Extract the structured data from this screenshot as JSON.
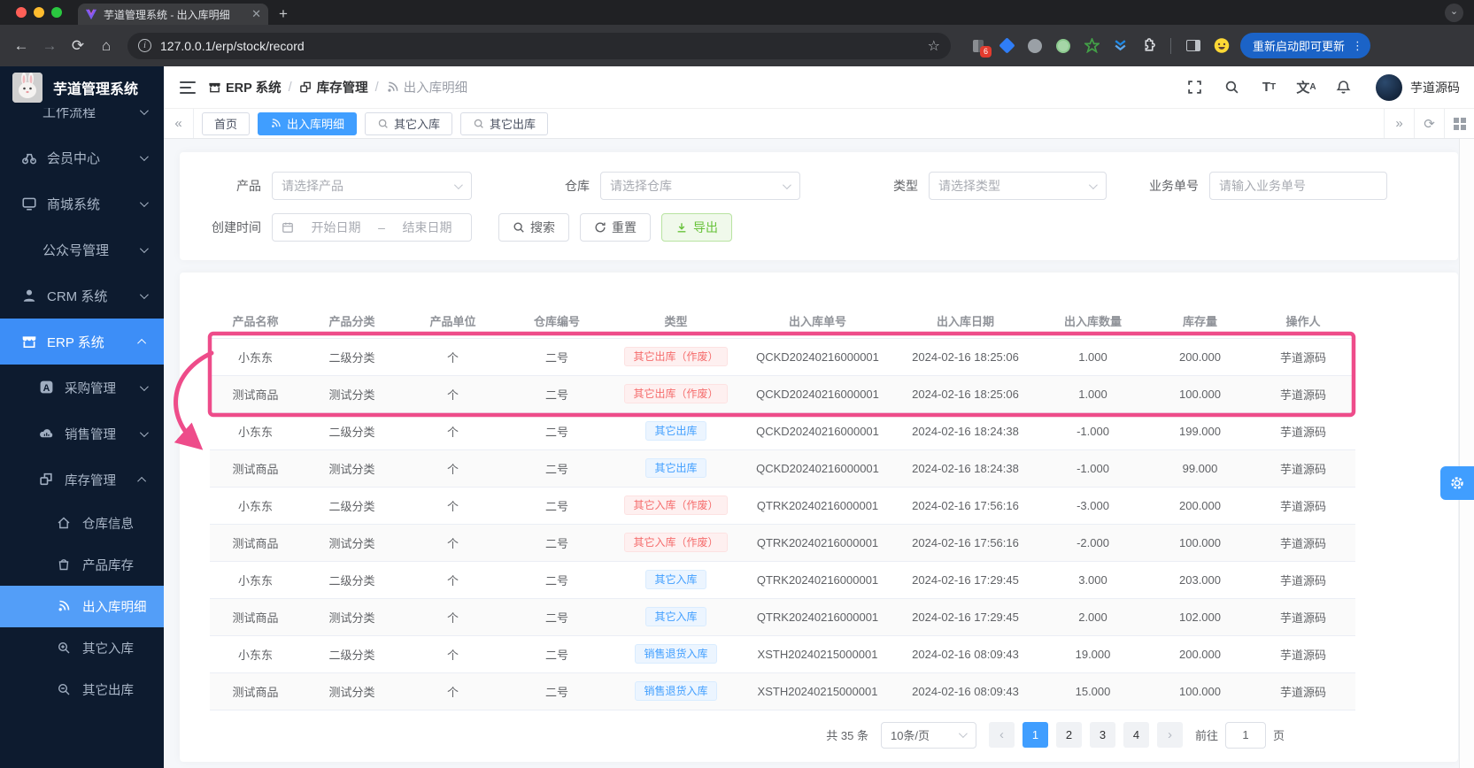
{
  "colors": {
    "accent": "#409eff",
    "success_green": "#67c23a",
    "danger_red": "#f56c6c",
    "annotation_pink": "#ee4c8a",
    "sidebar_bg": "#0d1b2f"
  },
  "browser": {
    "tab_title": "芋道管理系统 - 出入库明细",
    "url": "127.0.0.1/erp/stock/record",
    "extension_badge": "6",
    "update_button": "重新启动即可更新"
  },
  "sidebar": {
    "logo_title": "芋道管理系统",
    "items": [
      {
        "label": "工作流程"
      },
      {
        "label": "会员中心"
      },
      {
        "label": "商城系统"
      },
      {
        "label": "公众号管理"
      },
      {
        "label": "CRM 系统"
      },
      {
        "label": "ERP 系统"
      },
      {
        "label": "采购管理"
      },
      {
        "label": "销售管理"
      },
      {
        "label": "库存管理"
      },
      {
        "label": "仓库信息"
      },
      {
        "label": "产品库存"
      },
      {
        "label": "出入库明细"
      },
      {
        "label": "其它入库"
      },
      {
        "label": "其它出库"
      }
    ]
  },
  "header": {
    "breadcrumb": [
      "ERP 系统",
      "库存管理",
      "出入库明细"
    ],
    "user_name": "芋道源码"
  },
  "tags": [
    "首页",
    "出入库明细",
    "其它入库",
    "其它出库"
  ],
  "filter": {
    "product_label": "产品",
    "product_placeholder": "请选择产品",
    "warehouse_label": "仓库",
    "warehouse_placeholder": "请选择仓库",
    "type_label": "类型",
    "type_placeholder": "请选择类型",
    "bizno_label": "业务单号",
    "bizno_placeholder": "请输入业务单号",
    "time_label": "创建时间",
    "start_placeholder": "开始日期",
    "range_separator": "–",
    "end_placeholder": "结束日期",
    "search_label": "搜索",
    "reset_label": "重置",
    "export_label": "导出"
  },
  "table": {
    "columns": [
      "产品名称",
      "产品分类",
      "产品单位",
      "仓库编号",
      "类型",
      "出入库单号",
      "出入库日期",
      "出入库数量",
      "库存量",
      "操作人"
    ],
    "rows": [
      {
        "product": "小东东",
        "category": "二级分类",
        "unit": "个",
        "warehouse": "二号",
        "type": "其它出库（作废）",
        "type_badge": "red",
        "order_no": "QCKD20240216000001",
        "date": "2024-02-16 18:25:06",
        "qty": "1.000",
        "stock": "200.000",
        "operator": "芋道源码"
      },
      {
        "product": "测试商品",
        "category": "测试分类",
        "unit": "个",
        "warehouse": "二号",
        "type": "其它出库（作废）",
        "type_badge": "red",
        "order_no": "QCKD20240216000001",
        "date": "2024-02-16 18:25:06",
        "qty": "1.000",
        "stock": "100.000",
        "operator": "芋道源码"
      },
      {
        "product": "小东东",
        "category": "二级分类",
        "unit": "个",
        "warehouse": "二号",
        "type": "其它出库",
        "type_badge": "blue",
        "order_no": "QCKD20240216000001",
        "date": "2024-02-16 18:24:38",
        "qty": "-1.000",
        "stock": "199.000",
        "operator": "芋道源码"
      },
      {
        "product": "测试商品",
        "category": "测试分类",
        "unit": "个",
        "warehouse": "二号",
        "type": "其它出库",
        "type_badge": "blue",
        "order_no": "QCKD20240216000001",
        "date": "2024-02-16 18:24:38",
        "qty": "-1.000",
        "stock": "99.000",
        "operator": "芋道源码"
      },
      {
        "product": "小东东",
        "category": "二级分类",
        "unit": "个",
        "warehouse": "二号",
        "type": "其它入库（作废）",
        "type_badge": "red",
        "order_no": "QTRK20240216000001",
        "date": "2024-02-16 17:56:16",
        "qty": "-3.000",
        "stock": "200.000",
        "operator": "芋道源码"
      },
      {
        "product": "测试商品",
        "category": "测试分类",
        "unit": "个",
        "warehouse": "二号",
        "type": "其它入库（作废）",
        "type_badge": "red",
        "order_no": "QTRK20240216000001",
        "date": "2024-02-16 17:56:16",
        "qty": "-2.000",
        "stock": "100.000",
        "operator": "芋道源码"
      },
      {
        "product": "小东东",
        "category": "二级分类",
        "unit": "个",
        "warehouse": "二号",
        "type": "其它入库",
        "type_badge": "blue",
        "order_no": "QTRK20240216000001",
        "date": "2024-02-16 17:29:45",
        "qty": "3.000",
        "stock": "203.000",
        "operator": "芋道源码"
      },
      {
        "product": "测试商品",
        "category": "测试分类",
        "unit": "个",
        "warehouse": "二号",
        "type": "其它入库",
        "type_badge": "blue",
        "order_no": "QTRK20240216000001",
        "date": "2024-02-16 17:29:45",
        "qty": "2.000",
        "stock": "102.000",
        "operator": "芋道源码"
      },
      {
        "product": "小东东",
        "category": "二级分类",
        "unit": "个",
        "warehouse": "二号",
        "type": "销售退货入库",
        "type_badge": "blue",
        "order_no": "XSTH20240215000001",
        "date": "2024-02-16 08:09:43",
        "qty": "19.000",
        "stock": "200.000",
        "operator": "芋道源码"
      },
      {
        "product": "测试商品",
        "category": "测试分类",
        "unit": "个",
        "warehouse": "二号",
        "type": "销售退货入库",
        "type_badge": "blue",
        "order_no": "XSTH20240215000001",
        "date": "2024-02-16 08:09:43",
        "qty": "15.000",
        "stock": "100.000",
        "operator": "芋道源码"
      }
    ]
  },
  "pagination": {
    "total": "共 35 条",
    "page_size": "10条/页",
    "pages": [
      "1",
      "2",
      "3",
      "4"
    ],
    "active_page": "1",
    "goto_label": "前往",
    "goto_value": "1",
    "page_unit": "页"
  }
}
